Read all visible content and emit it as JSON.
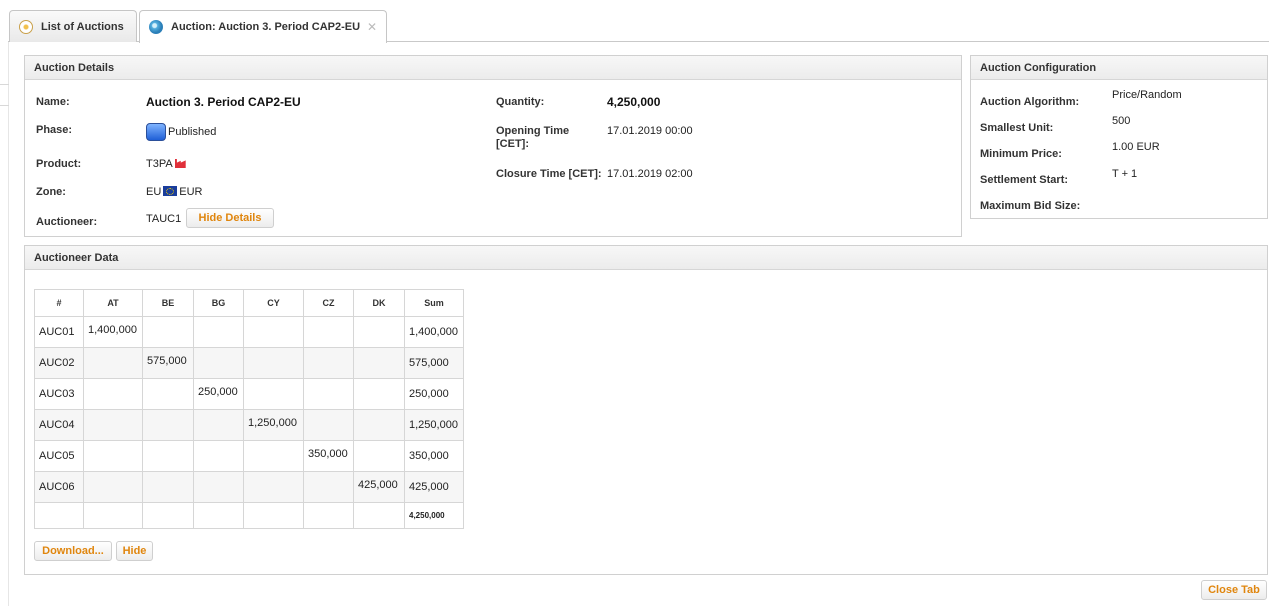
{
  "tabs": [
    {
      "label": "List of Auctions"
    },
    {
      "label": "Auction: Auction 3. Period CAP2-EU"
    }
  ],
  "auction_details": {
    "header": "Auction Details",
    "name_label": "Name:",
    "name_value": "Auction 3. Period CAP2-EU",
    "phase_label": "Phase:",
    "phase_value": "Published",
    "product_label": "Product:",
    "product_value": "T3PA",
    "zone_label": "Zone:",
    "zone_value": "EU",
    "zone_currency": "EUR",
    "auctioneer_label": "Auctioneer:",
    "auctioneer_value": "TAUC1",
    "hide_details_button": "Hide Details",
    "quantity_label": "Quantity:",
    "quantity_value": "4,250,000",
    "opening_time_label_1": "Opening Time",
    "opening_time_label_2": "[CET]:",
    "opening_time_value": "17.01.2019 00:00",
    "closure_time_label": "Closure Time [CET]:",
    "closure_time_value": "17.01.2019 02:00"
  },
  "auction_config": {
    "header": "Auction Configuration",
    "items": [
      {
        "label": "Auction Algorithm:",
        "value": "Price/Random"
      },
      {
        "label": "Smallest Unit:",
        "value": "500"
      },
      {
        "label": "Minimum Price:",
        "value": "1.00 EUR"
      },
      {
        "label": "Settlement Start:",
        "value": "T + 1"
      },
      {
        "label": "Maximum Bid Size:",
        "value": ""
      }
    ]
  },
  "auctioneer_data": {
    "header": "Auctioneer Data",
    "columns": [
      "#",
      "AT",
      "BE",
      "BG",
      "CY",
      "CZ",
      "DK",
      "Sum"
    ],
    "rows": [
      [
        "AUC01",
        "1,400,000",
        "",
        "",
        "",
        "",
        "",
        "1,400,000"
      ],
      [
        "AUC02",
        "",
        "575,000",
        "",
        "",
        "",
        "",
        "575,000"
      ],
      [
        "AUC03",
        "",
        "",
        "250,000",
        "",
        "",
        "",
        "250,000"
      ],
      [
        "AUC04",
        "",
        "",
        "",
        "1,250,000",
        "",
        "",
        "1,250,000"
      ],
      [
        "AUC05",
        "",
        "",
        "",
        "",
        "350,000",
        "",
        "350,000"
      ],
      [
        "AUC06",
        "",
        "",
        "",
        "",
        "",
        "425,000",
        "425,000"
      ]
    ],
    "total": "4,250,000",
    "download_button": "Download...",
    "hide_button": "Hide"
  },
  "close_tab_button": "Close Tab",
  "colors": {
    "accent_orange": "#e0860e",
    "border": "#d0d0d0",
    "header_bg": "#ececec"
  }
}
